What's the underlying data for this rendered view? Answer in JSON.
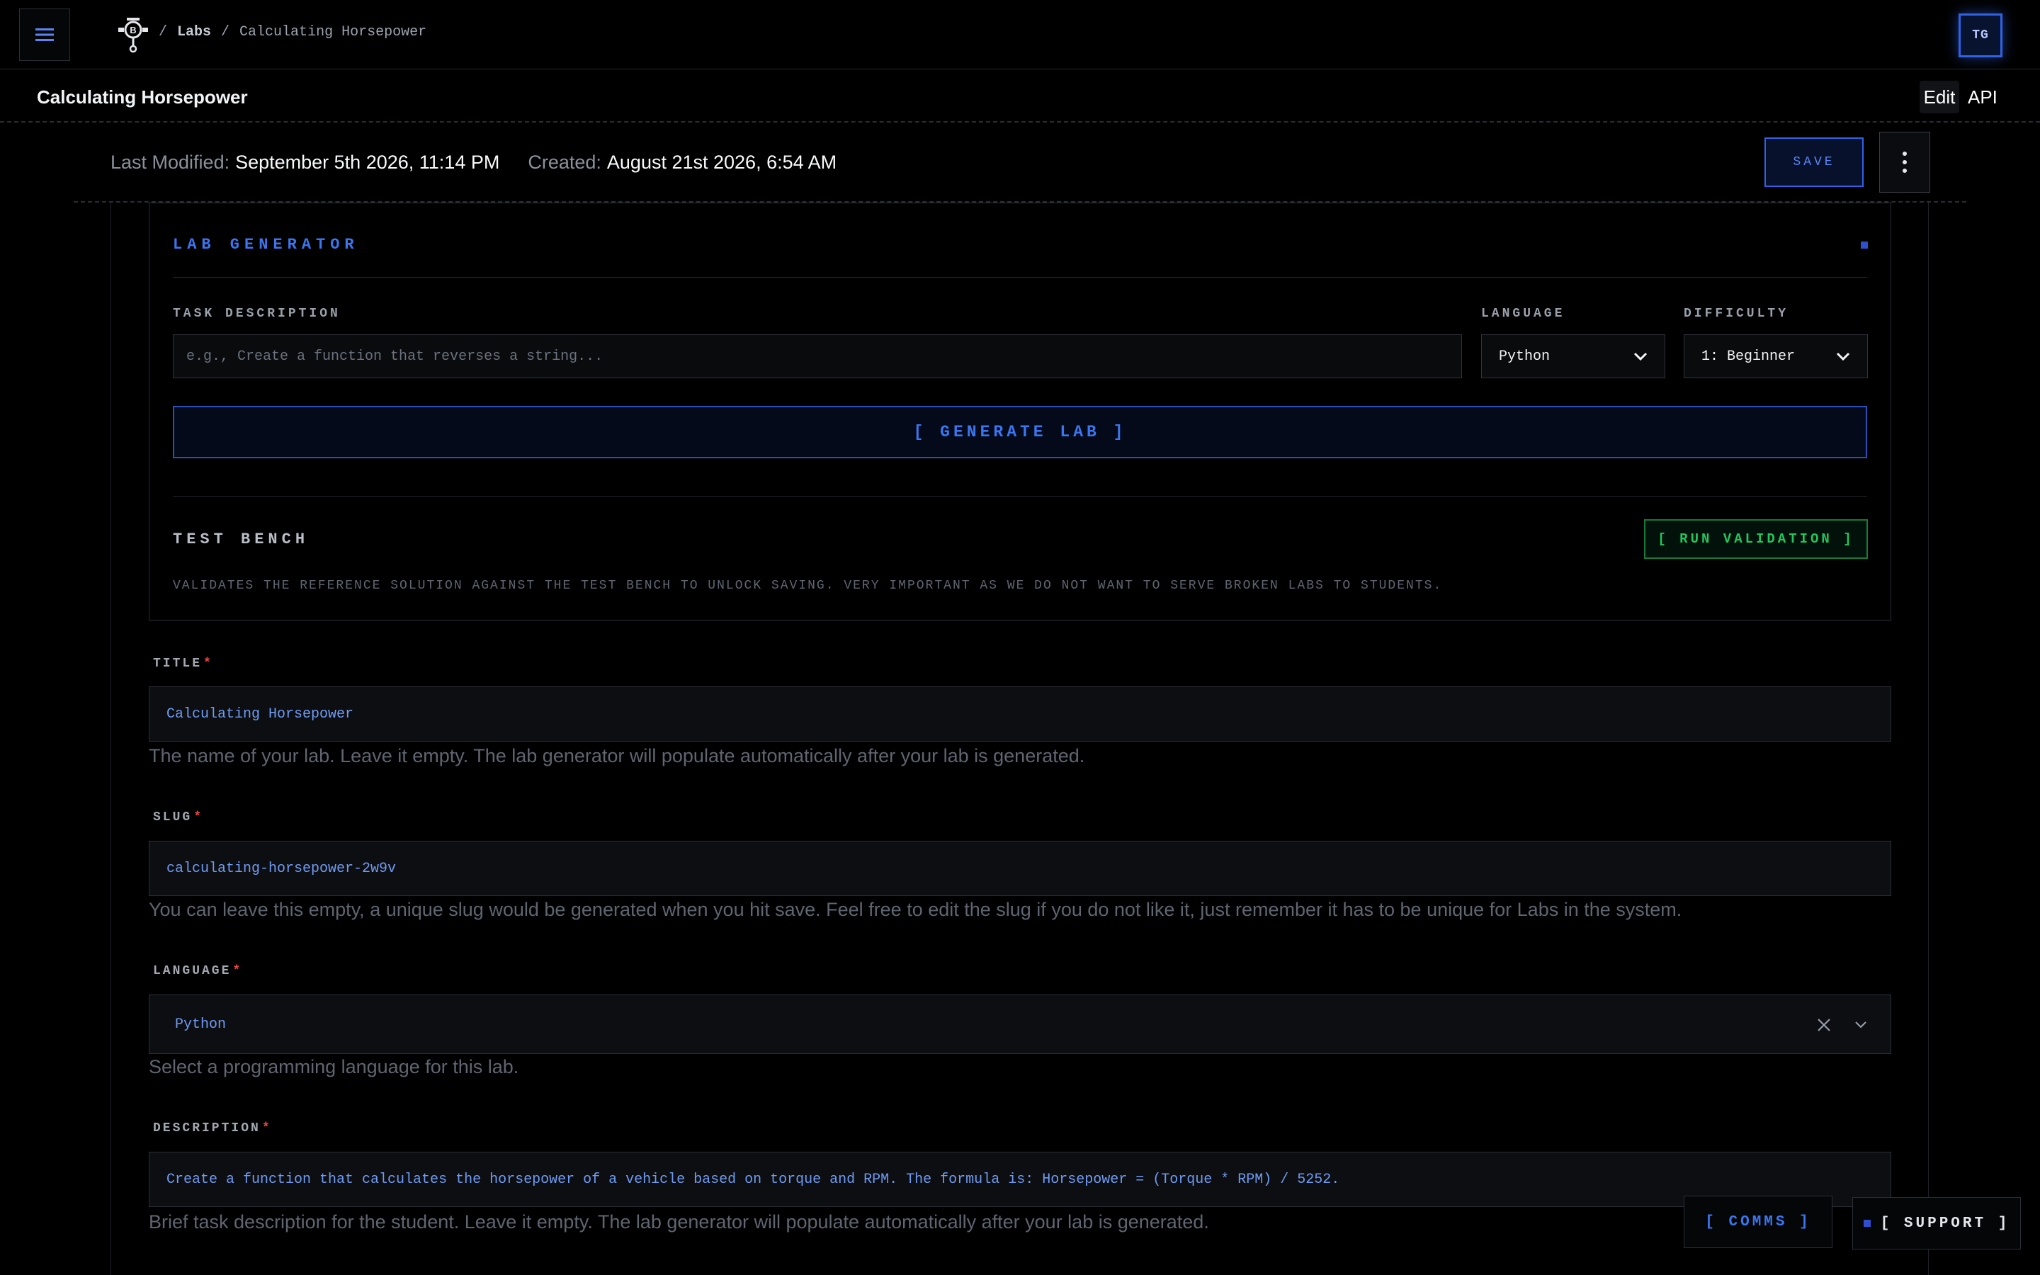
{
  "topbar": {
    "menu_icon": "hamburger-icon",
    "logo_icon": "robot-logo-icon",
    "breadcrumb": {
      "separator": "/",
      "section": "Labs",
      "current": "Calculating Horsepower"
    },
    "avatar_initials": "TG"
  },
  "header": {
    "title": "Calculating Horsepower",
    "tabs": [
      {
        "label": "Edit",
        "active": true
      },
      {
        "label": "API",
        "active": false
      }
    ]
  },
  "meta": {
    "last_modified_label": "Last Modified:",
    "last_modified_value": "September 5th 2026, 11:14 PM",
    "created_label": "Created:",
    "created_value": "August 21st 2026, 6:54 AM",
    "save_label": "SAVE",
    "more_icon": "vertical-ellipsis-icon"
  },
  "generator": {
    "title": "LAB GENERATOR",
    "task_label": "TASK DESCRIPTION",
    "task_placeholder": "e.g., Create a function that reverses a string...",
    "language_label": "LANGUAGE",
    "language_value": "Python",
    "difficulty_label": "DIFFICULTY",
    "difficulty_value": "1: Beginner",
    "generate_label": "[ GENERATE LAB ]",
    "test_bench_title": "TEST BENCH",
    "run_label": "[ RUN VALIDATION ]",
    "test_bench_desc": "VALIDATES THE REFERENCE SOLUTION AGAINST THE TEST BENCH TO UNLOCK SAVING. VERY IMPORTANT AS WE DO NOT WANT TO SERVE BROKEN LABS TO STUDENTS."
  },
  "form": {
    "title": {
      "label": "TITLE",
      "required_mark": "*",
      "value": "Calculating Horsepower",
      "help": "The name of your lab. Leave it empty. The lab generator will populate automatically after your lab is generated."
    },
    "slug": {
      "label": "SLUG",
      "required_mark": "*",
      "value": "calculating-horsepower-2w9v",
      "help": "You can leave this empty, a unique slug would be generated when you hit save. Feel free to edit the slug if you do not like it, just remember it has to be unique for Labs in the system."
    },
    "language": {
      "label": "LANGUAGE",
      "required_mark": "*",
      "value": "Python",
      "help": "Select a programming language for this lab."
    },
    "description": {
      "label": "DESCRIPTION",
      "required_mark": "*",
      "value": "Create a function that calculates the horsepower of a vehicle based on torque and RPM. The formula is: Horsepower = (Torque * RPM) / 5252.",
      "help": "Brief task description for the student. Leave it empty. The lab generator will populate automatically after your lab is generated."
    }
  },
  "floating": {
    "comms_label": "[ COMMS ]",
    "support_label": "[ SUPPORT ]"
  },
  "colors": {
    "background": "#000000",
    "accent_blue": "#3b76f0",
    "accent_green": "#22c55e",
    "required_red": "#ef4444"
  }
}
